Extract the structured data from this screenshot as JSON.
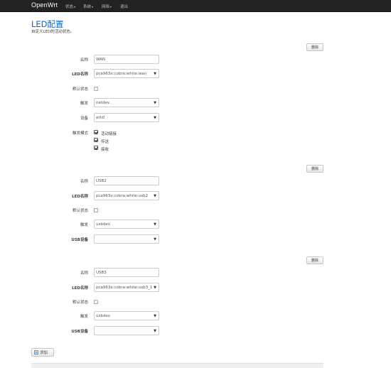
{
  "navbar": {
    "brand": "OpenWrt",
    "menus": [
      "状态",
      "系统",
      "网络"
    ],
    "logout": "退出"
  },
  "page": {
    "title": "LED配置",
    "description": "自定义LED的活动状态。"
  },
  "labels": {
    "name": "名称",
    "led_name": "LED名称",
    "default_state": "默认状态",
    "trigger": "触发",
    "device": "设备",
    "trigger_mode": "触发模式",
    "usb_device": "USB设备",
    "delete": "删除",
    "add": "添加"
  },
  "sections": [
    {
      "name_value": "WAN",
      "led_name_value": "pca963x:cobra:white:wan",
      "default_state_checked": false,
      "trigger_value": "netdev",
      "device_value": "eth0",
      "trigger_modes": [
        {
          "label": "活动链接",
          "checked": true
        },
        {
          "label": "传送",
          "checked": true
        },
        {
          "label": "接收",
          "checked": true
        }
      ]
    },
    {
      "name_value": "USB2",
      "led_name_value": "pca963x:cobra:white:usb2",
      "default_state_checked": false,
      "trigger_value": "usbdev",
      "usb_device_value": ""
    },
    {
      "name_value": "USB3",
      "led_name_value": "pca963x:cobra:white:usb3_1",
      "default_state_checked": false,
      "trigger_value": "usbdev",
      "usb_device_value": ""
    }
  ],
  "colors": {
    "navbar_bg": "#222222",
    "title_blue": "#0069d6"
  }
}
